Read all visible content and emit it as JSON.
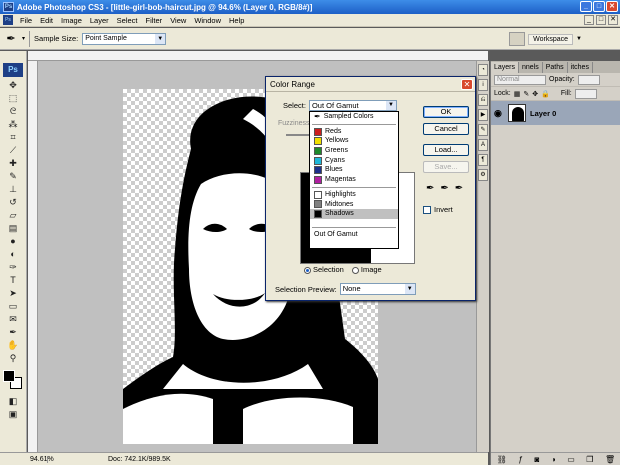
{
  "window": {
    "title": "Adobe Photoshop CS3 - [little-girl-bob-haircut.jpg @ 94.6% (Layer 0, RGB/8#)]",
    "app_icon": "Ps",
    "minimize": "_",
    "maximize": "□",
    "close": "✕"
  },
  "menu": [
    "File",
    "Edit",
    "Image",
    "Layer",
    "Select",
    "Filter",
    "View",
    "Window",
    "Help"
  ],
  "options": {
    "sample_size_label": "Sample Size:",
    "sample_size_value": "Point Sample",
    "workspace_label": "Workspace"
  },
  "toolbox": {
    "badge": "Ps",
    "tools": [
      "move-tool",
      "marquee-tool",
      "lasso-tool",
      "magic-wand-tool",
      "crop-tool",
      "slice-tool",
      "healing-brush-tool",
      "brush-tool",
      "clone-stamp-tool",
      "history-brush-tool",
      "eraser-tool",
      "gradient-tool",
      "blur-tool",
      "dodge-tool",
      "pen-tool",
      "type-tool",
      "path-selection-tool",
      "shape-tool",
      "notes-tool",
      "eyedropper-tool",
      "hand-tool",
      "zoom-tool"
    ]
  },
  "status": {
    "zoom": "94.61%",
    "doc": "Doc: 742.1K/989.5K"
  },
  "layers_panel": {
    "tabs": [
      "Layers",
      "Channels",
      "Paths",
      "Swatches"
    ],
    "tab_display": [
      "Layers",
      "nnels",
      "Paths",
      "itches"
    ],
    "blend_mode": "Normal",
    "opacity_label": "Opacity:",
    "lock_label": "Lock:",
    "fill_label": "Fill:",
    "layer_name": "Layer 0"
  },
  "dialog": {
    "title": "Color Range",
    "select_label": "Select:",
    "select_value": "Out Of Gamut",
    "fuzziness_label": "Fuzziness",
    "ok": "OK",
    "cancel": "Cancel",
    "load": "Load...",
    "save": "Save...",
    "invert_label": "Invert",
    "selection_label": "Selection",
    "image_label": "Image",
    "selection_preview_label": "Selection Preview:",
    "selection_preview_value": "None"
  },
  "dropdown": {
    "sampled": "Sampled Colors",
    "colors": [
      {
        "label": "Reds",
        "color": "#cc1f1f"
      },
      {
        "label": "Yellows",
        "color": "#f0e000"
      },
      {
        "label": "Greens",
        "color": "#1e8a2b"
      },
      {
        "label": "Cyans",
        "color": "#1fb7d8"
      },
      {
        "label": "Blues",
        "color": "#1d2f8a"
      },
      {
        "label": "Magentas",
        "color": "#b01fa0"
      }
    ],
    "tones": [
      {
        "label": "Highlights",
        "color": "#ffffff"
      },
      {
        "label": "Midtones",
        "color": "#808080"
      },
      {
        "label": "Shadows",
        "color": "#000000"
      }
    ],
    "gamut": "Out Of Gamut",
    "selected": "Shadows"
  }
}
